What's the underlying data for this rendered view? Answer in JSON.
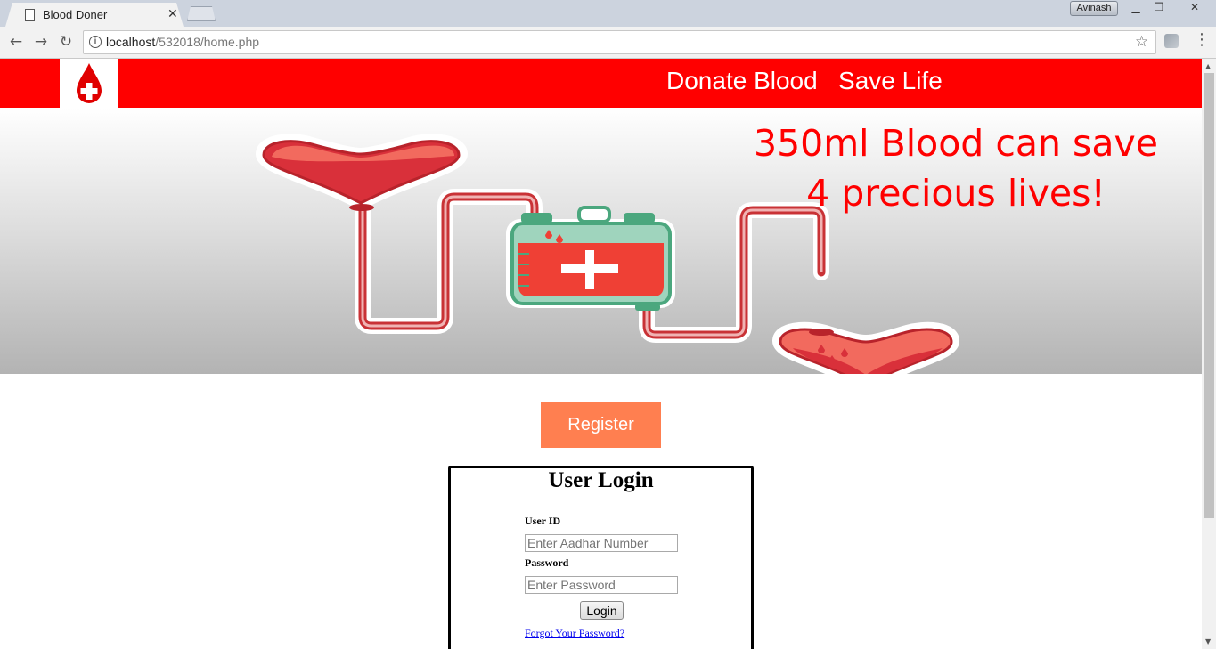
{
  "browser": {
    "tab_title": "Blood Doner",
    "url_host": "localhost",
    "url_path": "/532018/home.php",
    "profile_name": "Avinash"
  },
  "header": {
    "title": "Donate Blood   Save Life",
    "accent_color": "#ff0000"
  },
  "banner": {
    "line1": "350ml Blood can save",
    "line2": "4 precious lives!"
  },
  "register_label": "Register",
  "login": {
    "title": "User Login",
    "user_label": "User ID",
    "user_placeholder": "Enter Aadhar Number",
    "password_label": "Password",
    "password_placeholder": "Enter Password",
    "button_label": "Login",
    "forgot_label": "Forgot Your Password?"
  }
}
